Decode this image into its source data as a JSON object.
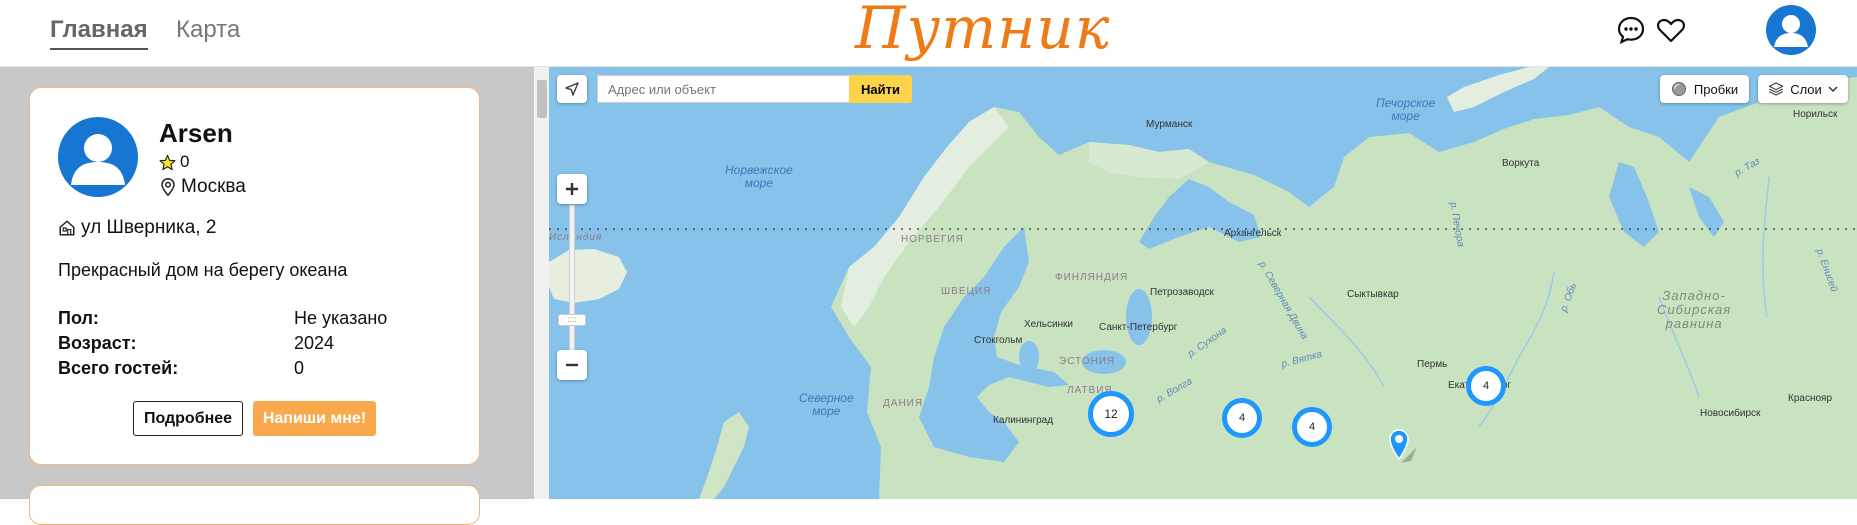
{
  "header": {
    "nav_main": "Главная",
    "nav_map": "Карта",
    "logo": "Путник",
    "icons": [
      "chat-icon",
      "heart-icon",
      "user-avatar-icon"
    ]
  },
  "card": {
    "name": "Arsen",
    "rating": "0",
    "city": "Москва",
    "address": "ул Шверника, 2",
    "description": "Прекрасный дом на берегу океана",
    "info": [
      {
        "key": "Пол:",
        "value": "Не указано"
      },
      {
        "key": "Возраст:",
        "value": "2024"
      },
      {
        "key": "Всего гостей:",
        "value": "0"
      }
    ],
    "btn_more": "Подробнее",
    "btn_write": "Напиши мне!"
  },
  "map": {
    "search_placeholder": "Адрес или объект",
    "search_button": "Найти",
    "traffic_label": "Пробки",
    "layers_label": "Слои",
    "seas": {
      "norwegian": "Норвежское\nморе",
      "pechora": "Печорское\nморе",
      "north": "Северное\nморе"
    },
    "countries": {
      "iceland": "Исландия",
      "norway": "НОРВЕГИЯ",
      "sweden": "ШВЕЦИЯ",
      "finland": "ФИНЛЯНДИЯ",
      "estonia": "ЭСТОНИЯ",
      "latvia": "ЛАТВИЯ",
      "denmark": "ДАНИЯ"
    },
    "region": "Западно-\nСибирская\nравнина",
    "cities": {
      "murmansk": "Мурманск",
      "vorkuta": "Воркута",
      "norilsk": "Норильск",
      "arkhangelsk": "Архангельск",
      "petrozavodsk": "Петрозаводск",
      "syktyvkar": "Сыктывкар",
      "helsinki": "Хельсинки",
      "spb": "Санкт-Петербург",
      "stockholm": "Стокгольм",
      "perm": "Пермь",
      "yekaterinburg": "Екатеринбург",
      "krasnoyarsk": "Краснояр",
      "kaliningrad": "Калининград",
      "novosibirsk": "Новосибирск"
    },
    "rivers": {
      "pechora": "р. Печора",
      "sev_dvina": "р. Северная Двина",
      "sukhona": "р. Сухона",
      "vyatka": "р. Вятка",
      "volga": "р. Волга",
      "ob": "р. Обь",
      "taz": "р. Таз",
      "yenisei": "р. Енисей"
    },
    "clusters": [
      "12",
      "4",
      "4",
      "4"
    ]
  }
}
